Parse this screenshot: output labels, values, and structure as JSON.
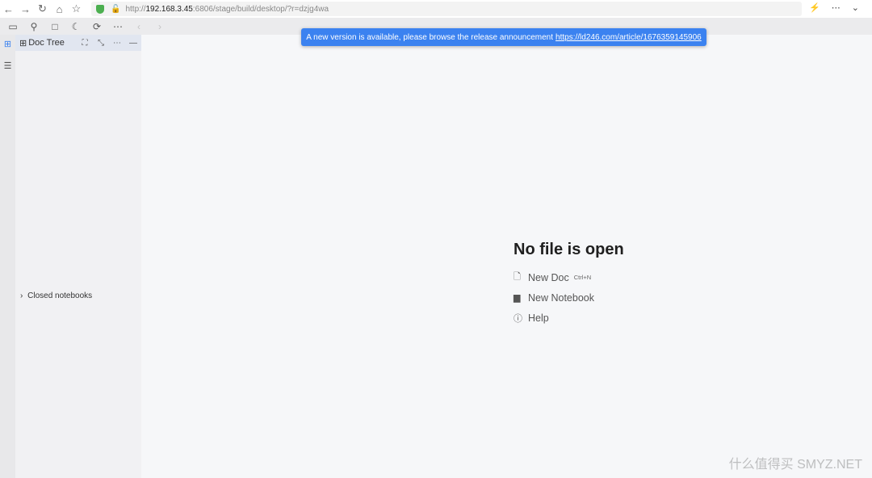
{
  "browser": {
    "url_prefix": "http://",
    "url_host": "192.168.3.45",
    "url_rest": ":6806/stage/build/desktop/?r=dzjg4wa"
  },
  "sidebar": {
    "title": "Doc Tree",
    "closed_notebooks": "Closed notebooks"
  },
  "toast": {
    "text": "A new version is available, please browse the release announcement",
    "link": "https://ld246.com/article/1676359145906",
    "color": "#3b82f0"
  },
  "main": {
    "title": "No file is open",
    "actions": [
      {
        "label": "New Doc",
        "shortcut": "Ctrl+N",
        "icon": "file-icon"
      },
      {
        "label": "New Notebook",
        "shortcut": "",
        "icon": "notebook-icon"
      },
      {
        "label": "Help",
        "shortcut": "",
        "icon": "help-icon"
      }
    ]
  },
  "watermark": "什么值得买 SMYZ.NET"
}
